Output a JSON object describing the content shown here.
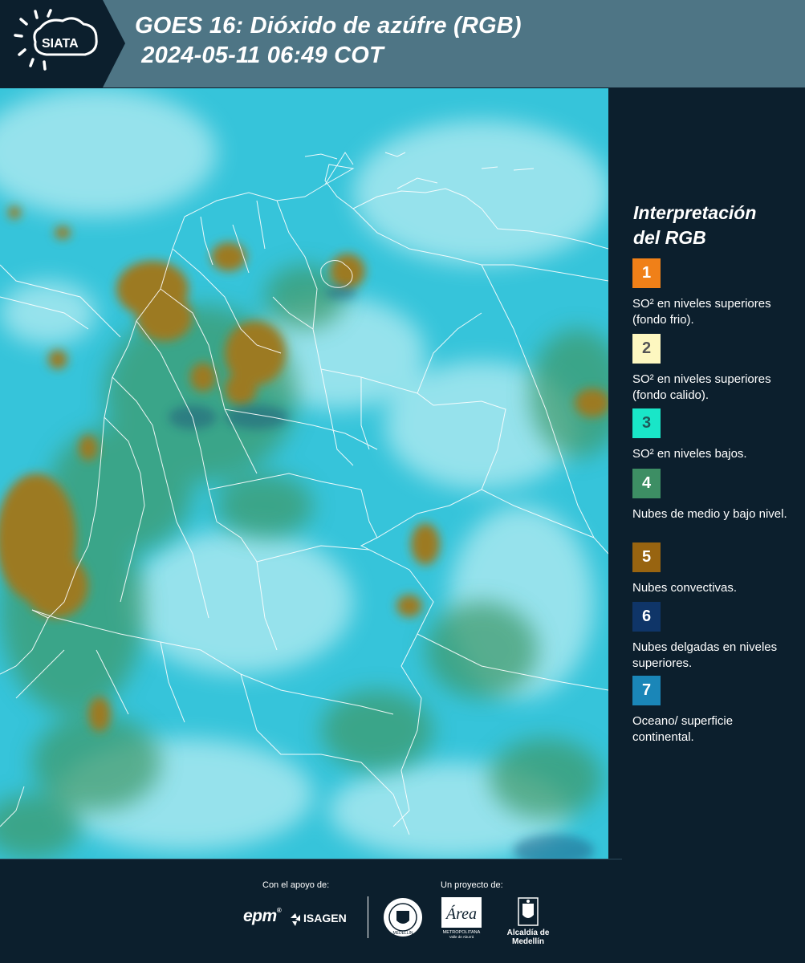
{
  "header": {
    "logo_text": "SIATA",
    "title_line1": "GOES 16: Dióxido de azúfre (RGB)",
    "title_line2": " 2024-05-11 06:49 COT"
  },
  "legend": {
    "title_line1": "Interpretación",
    "title_line2": "del RGB",
    "items": [
      {
        "number": "1",
        "color": "#f08018",
        "text_color": "#ffffff",
        "text": "SO² en niveles superiores (fondo frio)."
      },
      {
        "number": "2",
        "color": "#fdf7c0",
        "text_color": "#555555",
        "text": "SO² en niveles superiores (fondo calido)."
      },
      {
        "number": "3",
        "color": "#19e6c8",
        "text_color": "#1e5a5a",
        "text": "SO² en niveles bajos."
      },
      {
        "number": "4",
        "color": "#3d8e64",
        "text_color": "#ffffff",
        "text": "Nubes de medio y bajo nivel."
      },
      {
        "number": "5",
        "color": "#986410",
        "text_color": "#ffffff",
        "text": "Nubes convectivas."
      },
      {
        "number": "6",
        "color": "#0f3568",
        "text_color": "#ffffff",
        "text": "Nubes delgadas en niveles superiores."
      },
      {
        "number": "7",
        "color": "#1a86b8",
        "text_color": "#ffffff",
        "text": "Oceano/ superficie continental."
      }
    ]
  },
  "footer": {
    "support_label": "Con el apoyo de:",
    "project_label": "Un proyecto de:",
    "epm": "epm",
    "isagen": "ISAGEN",
    "medellin": "MEDELLÍN",
    "area_script": "Área",
    "area_line1": "METROPOLITANA",
    "area_line2": "Valle de Aburrá",
    "alcaldia": "Alcaldía de Medellín"
  },
  "map": {
    "image": "satellite-so2-rgb-colombia",
    "colors": {
      "ocean": "#38c6dc",
      "low_cloud": "#3d8e64",
      "convective": "#9a7a1f",
      "high_cloud": "#a8e6ee",
      "border": "#ffffff"
    }
  }
}
